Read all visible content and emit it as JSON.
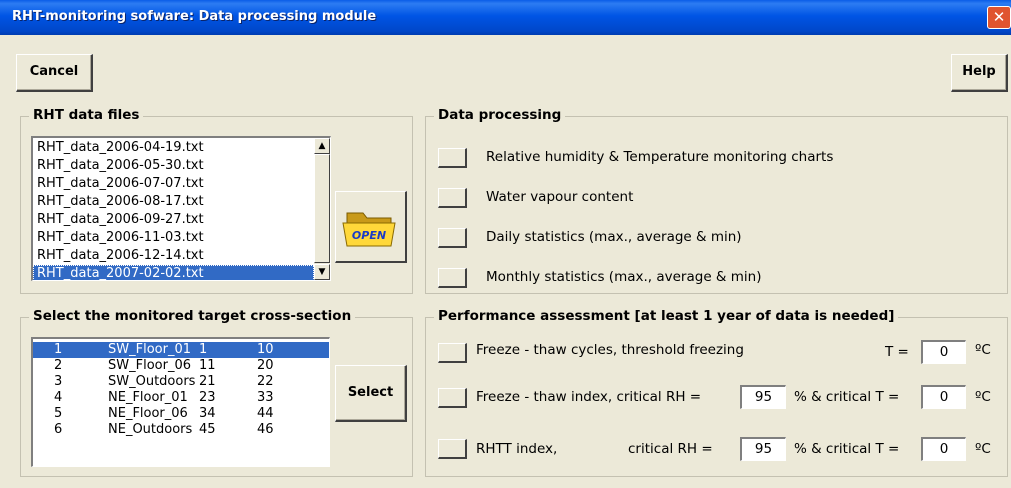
{
  "window": {
    "title": "RHT-monitoring sofware:  Data processing module",
    "close_glyph": "✕"
  },
  "toolbar": {
    "cancel_label": "Cancel",
    "help_label": "Help"
  },
  "files_group": {
    "legend": "RHT data files",
    "files": [
      "RHT_data_2006-04-19.txt",
      "RHT_data_2006-05-30.txt",
      "RHT_data_2006-07-07.txt",
      "RHT_data_2006-08-17.txt",
      "RHT_data_2006-09-27.txt",
      "RHT_data_2006-11-03.txt",
      "RHT_data_2006-12-14.txt",
      "RHT_data_2007-02-02.txt"
    ],
    "selected_index": 7,
    "open_label": "OPEN"
  },
  "processing_group": {
    "legend": "Data processing",
    "options": [
      "Relative humidity & Temperature monitoring charts",
      "Water vapour content",
      "Daily statistics (max., average & min)",
      "Monthly statistics (max., average & min)"
    ]
  },
  "cross_section_group": {
    "legend": "Select the monitored target cross-section",
    "rows": [
      [
        "1",
        "SW_Floor_01",
        "1",
        "10"
      ],
      [
        "2",
        "SW_Floor_06",
        "11",
        "20"
      ],
      [
        "3",
        "SW_Outdoors",
        "21",
        "22"
      ],
      [
        "4",
        "NE_Floor_01",
        "23",
        "33"
      ],
      [
        "5",
        "NE_Floor_06",
        "34",
        "44"
      ],
      [
        "6",
        "NE_Outdoors",
        "45",
        "46"
      ]
    ],
    "selected_index": 0,
    "select_label": "Select"
  },
  "performance_group": {
    "legend": "Performance assessment [at least 1 year of data is needed]",
    "freeze_thaw_cycles": {
      "label": "Freeze - thaw cycles, threshold freezing",
      "t_label": "T =",
      "t_value": "0",
      "unit": "ºC"
    },
    "freeze_thaw_index": {
      "label": "Freeze - thaw index, critical RH =",
      "rh_value": "95",
      "mid_label": "% & critical T =",
      "t_value": "0",
      "unit": "ºC"
    },
    "rhtt_index": {
      "label": "RHTT index,",
      "rh_label": "critical RH =",
      "rh_value": "95",
      "mid_label": "% & critical T =",
      "t_value": "0",
      "unit": "ºC"
    }
  }
}
